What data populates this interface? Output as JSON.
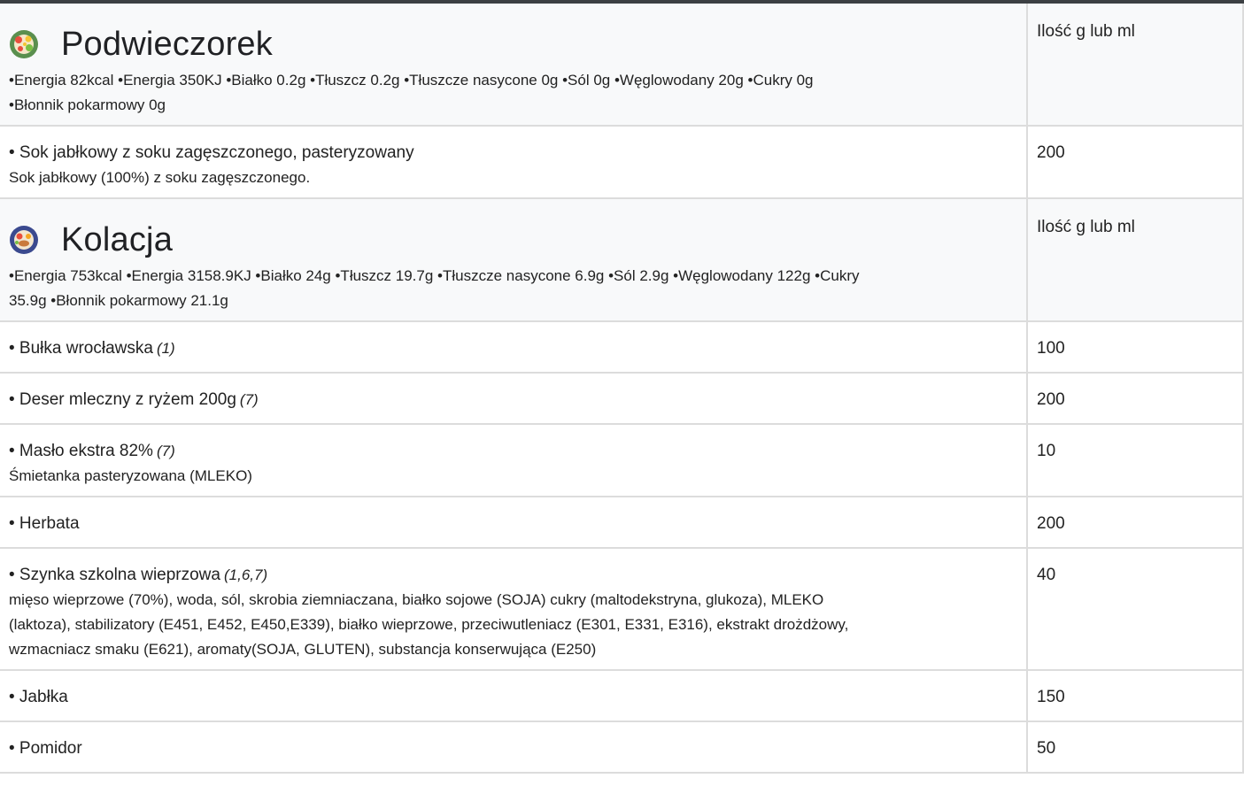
{
  "sections": [
    {
      "title": "Podwieczorek",
      "icon": "snack-plate-icon",
      "qty_header": "Ilość g lub ml",
      "nutrition_line1": "•Energia 82kcal •Energia 350KJ •Białko 0.2g •Tłuszcz 0.2g •Tłuszcze nasycone 0g •Sól 0g •Węglowodany 20g •Cukry 0g",
      "nutrition_line2": "•Błonnik pokarmowy 0g",
      "items": [
        {
          "name": "• Sok jabłkowy z soku zagęszczonego, pasteryzowany",
          "allergens": "",
          "desc": [
            "Sok jabłkowy (100%) z soku zagęszczonego."
          ],
          "qty": "200"
        }
      ]
    },
    {
      "title": "Kolacja",
      "icon": "dinner-plate-icon",
      "qty_header": "Ilość g lub ml",
      "nutrition_line1": "•Energia 753kcal •Energia 3158.9KJ •Białko 24g •Tłuszcz 19.7g •Tłuszcze nasycone 6.9g •Sól 2.9g •Węglowodany 122g •Cukry",
      "nutrition_line2": "35.9g •Błonnik pokarmowy 21.1g",
      "items": [
        {
          "name": "• Bułka wrocławska",
          "allergens": "(1)",
          "desc": [],
          "qty": "100"
        },
        {
          "name": "• Deser mleczny z ryżem 200g",
          "allergens": "(7)",
          "desc": [],
          "qty": "200"
        },
        {
          "name": "• Masło ekstra 82%",
          "allergens": "(7)",
          "desc": [
            "Śmietanka pasteryzowana (MLEKO)"
          ],
          "qty": "10"
        },
        {
          "name": "• Herbata",
          "allergens": "",
          "desc": [],
          "qty": "200"
        },
        {
          "name": "• Szynka szkolna wieprzowa",
          "allergens": "(1,6,7)",
          "desc": [
            "mięso wieprzowe (70%), woda, sól, skrobia ziemniaczana, białko sojowe (SOJA) cukry (maltodekstryna, glukoza), MLEKO",
            "(laktoza), stabilizatory (E451, E452, E450,E339), białko wieprzowe, przeciwutleniacz (E301, E331, E316), ekstrakt drożdżowy,",
            "wzmacniacz smaku (E621), aromaty(SOJA, GLUTEN), substancja konserwująca (E250)"
          ],
          "qty": "40"
        },
        {
          "name": "• Jabłka",
          "allergens": "",
          "desc": [],
          "qty": "150"
        },
        {
          "name": "• Pomidor",
          "allergens": "",
          "desc": [],
          "qty": "50"
        }
      ]
    }
  ]
}
